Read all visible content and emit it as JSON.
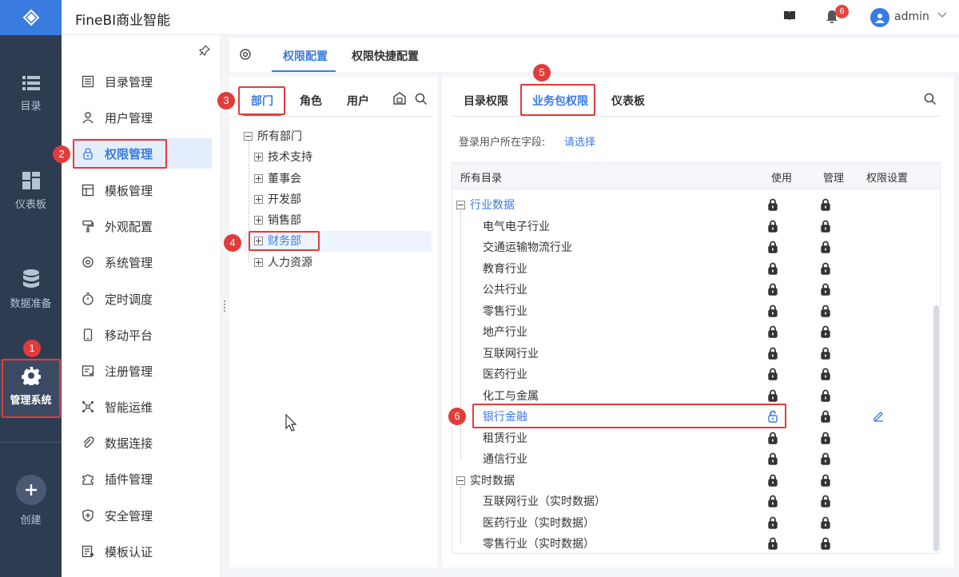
{
  "app": {
    "title": "FineBI商业智能"
  },
  "header": {
    "notification_count": "6",
    "user": "admin"
  },
  "rail": {
    "items": [
      {
        "label": "目录",
        "icon": "list-icon"
      },
      {
        "label": "仪表板",
        "icon": "dashboard-icon"
      },
      {
        "label": "数据准备",
        "icon": "database-icon"
      },
      {
        "label": "管理系统",
        "icon": "gear-icon"
      },
      {
        "label": "创建",
        "icon": "plus-icon"
      }
    ]
  },
  "menu": {
    "items": [
      {
        "label": "目录管理",
        "icon": "catalog-icon"
      },
      {
        "label": "用户管理",
        "icon": "user-icon"
      },
      {
        "label": "权限管理",
        "icon": "lock-icon",
        "active": true
      },
      {
        "label": "模板管理",
        "icon": "template-icon"
      },
      {
        "label": "外观配置",
        "icon": "paint-icon"
      },
      {
        "label": "系统管理",
        "icon": "settings-icon"
      },
      {
        "label": "定时调度",
        "icon": "timer-icon"
      },
      {
        "label": "移动平台",
        "icon": "mobile-icon"
      },
      {
        "label": "注册管理",
        "icon": "register-icon"
      },
      {
        "label": "智能运维",
        "icon": "ops-icon"
      },
      {
        "label": "数据连接",
        "icon": "link-icon"
      },
      {
        "label": "插件管理",
        "icon": "plugin-icon"
      },
      {
        "label": "安全管理",
        "icon": "shield-icon"
      },
      {
        "label": "模板认证",
        "icon": "cert-icon"
      }
    ]
  },
  "content_tabs": {
    "permission_config": "权限配置",
    "quick_config": "权限快捷配置"
  },
  "left_panel": {
    "tabs": [
      "部门",
      "角色",
      "用户"
    ],
    "tree_root": "所有部门",
    "tree_items": [
      "技术支持",
      "董事会",
      "开发部",
      "销售部",
      "财务部",
      "人力资源"
    ]
  },
  "right_panel": {
    "tabs": [
      "目录权限",
      "业务包权限",
      "仪表板"
    ],
    "login_field_label": "登录用户所在字段:",
    "login_field_link": "请选择",
    "table_headers": {
      "catalog": "所有目录",
      "use": "使用",
      "manage": "管理",
      "settings": "权限设置"
    },
    "groups": [
      {
        "name": "行业数据",
        "items": [
          "电气电子行业",
          "交通运输物流行业",
          "教育行业",
          "公共行业",
          "零售行业",
          "地产行业",
          "互联网行业",
          "医药行业",
          "化工与金属",
          "银行金融",
          "租赁行业",
          "通信行业"
        ]
      },
      {
        "name": "实时数据",
        "items": [
          "互联网行业（实时数据）",
          "医药行业（实时数据）",
          "零售行业（实时数据）"
        ]
      }
    ]
  },
  "annotations": [
    "1",
    "2",
    "3",
    "4",
    "5",
    "6"
  ],
  "colors": {
    "accent": "#3a7be0",
    "rail_bg": "#2e3c52",
    "annotation": "#e23b3b"
  }
}
